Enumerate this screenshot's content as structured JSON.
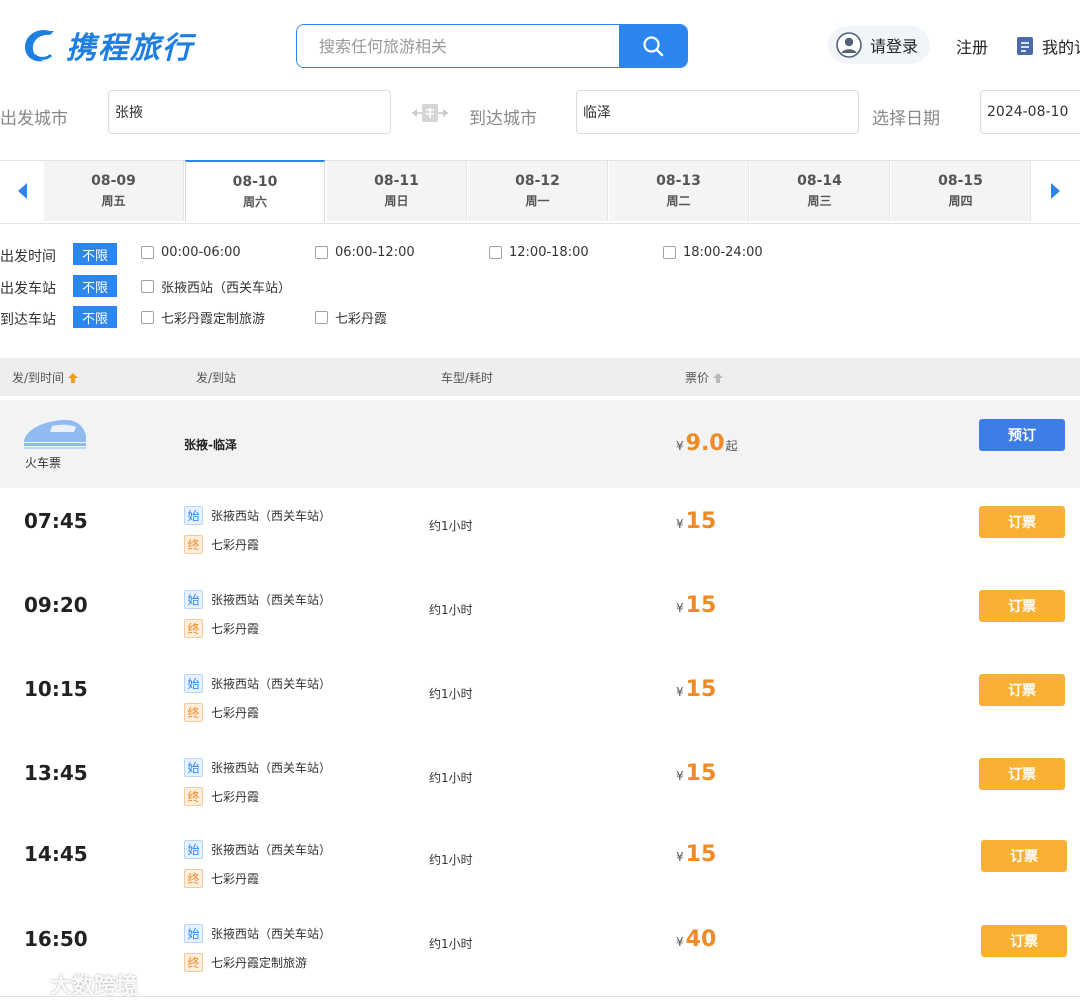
{
  "header": {
    "logo_text": "携程旅行",
    "search_placeholder": "搜索任何旅游相关",
    "login_label": "请登录",
    "register_label": "注册",
    "my_orders_label": "我的订"
  },
  "route_form": {
    "from_label": "出发城市",
    "from_value": "张掖",
    "to_label": "到达城市",
    "to_value": "临泽",
    "date_label": "选择日期",
    "date_value": "2024-08-10"
  },
  "dates": [
    {
      "md": "08-09",
      "weekday": "周五"
    },
    {
      "md": "08-10",
      "weekday": "周六",
      "active": true
    },
    {
      "md": "08-11",
      "weekday": "周日"
    },
    {
      "md": "08-12",
      "weekday": "周一"
    },
    {
      "md": "08-13",
      "weekday": "周二"
    },
    {
      "md": "08-14",
      "weekday": "周三"
    },
    {
      "md": "08-15",
      "weekday": "周四"
    }
  ],
  "filters": {
    "unlimited_label": "不限",
    "depart_time": {
      "label": "出发时间",
      "options": [
        "00:00-06:00",
        "06:00-12:00",
        "12:00-18:00",
        "18:00-24:00"
      ]
    },
    "depart_station": {
      "label": "出发车站",
      "options": [
        "张掖西站（西关车站）"
      ]
    },
    "arrive_station": {
      "label": "到达车站",
      "options": [
        "七彩丹霞定制旅游",
        "七彩丹霞"
      ]
    }
  },
  "table_header": {
    "col_time": "发/到时间",
    "col_station": "发/到站",
    "col_type": "车型/耗时",
    "col_price": "票价"
  },
  "summary": {
    "train_label": "火车票",
    "route": "张掖-临泽",
    "currency": "¥",
    "price": "9.0",
    "price_suffix": "起",
    "button": "预订"
  },
  "trip_common": {
    "start_tag": "始",
    "end_tag": "终",
    "currency": "¥",
    "button": "订票"
  },
  "trips": [
    {
      "time": "07:45",
      "from": "张掖西站（西关车站）",
      "to": "七彩丹霞",
      "duration": "约1小时",
      "price": "15"
    },
    {
      "time": "09:20",
      "from": "张掖西站（西关车站）",
      "to": "七彩丹霞",
      "duration": "约1小时",
      "price": "15"
    },
    {
      "time": "10:15",
      "from": "张掖西站（西关车站）",
      "to": "七彩丹霞",
      "duration": "约1小时",
      "price": "15"
    },
    {
      "time": "13:45",
      "from": "张掖西站（西关车站）",
      "to": "七彩丹霞",
      "duration": "约1小时",
      "price": "15"
    },
    {
      "time": "14:45",
      "from": "张掖西站（西关车站）",
      "to": "七彩丹霞",
      "duration": "约1小时",
      "price": "15"
    },
    {
      "time": "16:50",
      "from": "张掖西站（西关车站）",
      "to": "七彩丹霞定制旅游",
      "duration": "约1小时",
      "price": "40"
    }
  ],
  "watermark": "大数跨境",
  "colors": {
    "accent": "#2d86f0",
    "price": "#f08a24",
    "book": "#f8b133"
  }
}
